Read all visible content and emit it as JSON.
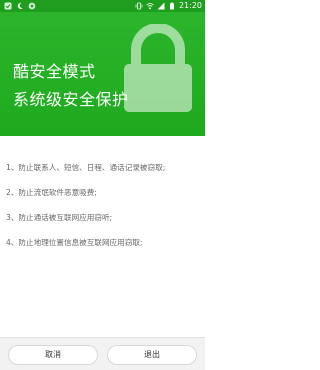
{
  "status_bar": {
    "time": "21:20",
    "left_icons": [
      "app-icon",
      "moon-icon",
      "app2-icon"
    ],
    "right_icons": [
      "vibrate-icon",
      "wifi-icon",
      "signal-icon",
      "battery-icon"
    ]
  },
  "hero": {
    "title_line1": "酷安全模式",
    "title_line2": "系统级安全保护",
    "background_color": "#1ea91e"
  },
  "items": [
    "1、防止联系人、短信、日程、通话记录被窃取;",
    "2、防止流氓软件恶意吸费;",
    "3、防止通话被互联网应用窃听;",
    "4、防止地理位置信息被互联网应用窃取;"
  ],
  "footer": {
    "cancel_label": "取消",
    "exit_label": "退出"
  }
}
